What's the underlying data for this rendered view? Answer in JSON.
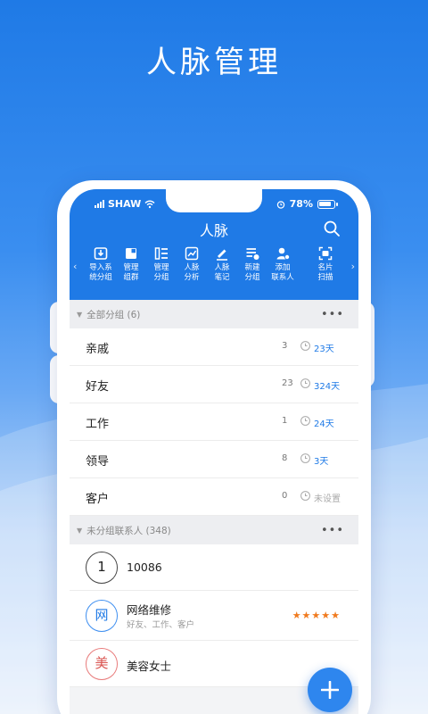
{
  "headline": "人脉管理",
  "status": {
    "carrier": "SHAW",
    "battery": "78%"
  },
  "appbar": {
    "title": "人脉"
  },
  "tools": [
    {
      "label": "导入系\n统分组",
      "icon": "import-icon"
    },
    {
      "label": "管理\n组群",
      "icon": "group-manage-icon"
    },
    {
      "label": "管理\n分组",
      "icon": "list-manage-icon"
    },
    {
      "label": "人脉\n分析",
      "icon": "chart-icon"
    },
    {
      "label": "人脉\n笔记",
      "icon": "pen-icon"
    },
    {
      "label": "新建\n分组",
      "icon": "new-group-icon"
    },
    {
      "label": "添加\n联系人",
      "icon": "add-contact-icon"
    },
    {
      "label": "名片\n扫描",
      "icon": "scan-icon"
    }
  ],
  "groups_section": {
    "title": "全部分组 (6)"
  },
  "groups": [
    {
      "name": "亲戚",
      "count": "3",
      "days": "23天"
    },
    {
      "name": "好友",
      "count": "23",
      "days": "324天"
    },
    {
      "name": "工作",
      "count": "1",
      "days": "24天"
    },
    {
      "name": "领导",
      "count": "8",
      "days": "3天"
    },
    {
      "name": "客户",
      "count": "0",
      "days": "未设置"
    }
  ],
  "ungrouped_section": {
    "title": "未分组联系人 (348)"
  },
  "contacts": [
    {
      "avatar": "1",
      "name": "10086"
    },
    {
      "avatar": "网",
      "name": "网络维修",
      "sub": "好友、工作、客户",
      "stars": "★★★★★"
    },
    {
      "avatar": "美",
      "name": "美容女士"
    }
  ],
  "colors": {
    "primary": "#1f7ae6",
    "star": "#f07a1e"
  }
}
